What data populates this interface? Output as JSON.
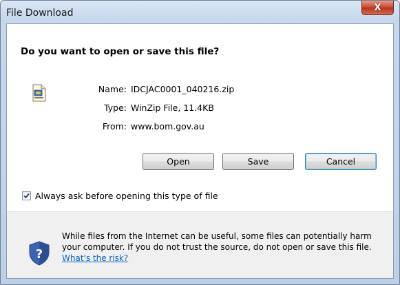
{
  "window": {
    "title": "File Download",
    "close_label": "X"
  },
  "dialog": {
    "question": "Do you want to open or save this file?",
    "info": {
      "name_label": "Name:",
      "name_value": "IDCJAC0001_040216.zip",
      "type_label": "Type:",
      "type_value": "WinZip File, 11.4KB",
      "from_label": "From:",
      "from_value": "www.bom.gov.au"
    },
    "buttons": {
      "open": "Open",
      "save": "Save",
      "cancel": "Cancel"
    },
    "checkbox": {
      "label": "Always ask before opening this type of file",
      "checked": true
    },
    "warning": {
      "text": "While files from the Internet can be useful, some files can potentially harm your computer. If you do not trust the source, do not open or save this file.",
      "link": "What's the risk?"
    }
  },
  "icons": {
    "file": "zip-file-icon",
    "shield": "security-shield-question-icon",
    "close": "close-icon",
    "check": "checkmark-icon"
  },
  "colors": {
    "link": "#0066cc",
    "close_button": "#c8452c",
    "title_bar": "#c7d8ec"
  }
}
